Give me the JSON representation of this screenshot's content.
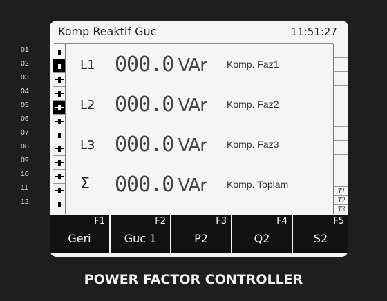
{
  "screen": {
    "title": "Komp Reaktif Guc",
    "clock": "11:51:27"
  },
  "channels": [
    "01",
    "02",
    "03",
    "04",
    "05",
    "06",
    "07",
    "08",
    "09",
    "10",
    "11",
    "12"
  ],
  "steps": [
    {
      "active": false
    },
    {
      "active": true
    },
    {
      "active": false
    },
    {
      "active": false
    },
    {
      "active": true
    },
    {
      "active": false
    },
    {
      "active": false
    },
    {
      "active": false
    },
    {
      "active": false
    },
    {
      "active": false
    },
    {
      "active": false
    },
    {
      "active": false
    }
  ],
  "readings": [
    {
      "label": "L1",
      "value": "000.0",
      "unit": "VAr",
      "desc": "Komp. Faz1"
    },
    {
      "label": "L2",
      "value": "000.0",
      "unit": "VAr",
      "desc": "Komp. Faz2"
    },
    {
      "label": "L3",
      "value": "000.0",
      "unit": "VAr",
      "desc": "Komp. Faz3"
    },
    {
      "label": "Σ",
      "value": "000.0",
      "unit": "VAr",
      "desc": "Komp. Toplam"
    }
  ],
  "side_tags": [
    "T1",
    "T2",
    "T3"
  ],
  "function_keys": [
    {
      "code": "F1",
      "label": "Geri"
    },
    {
      "code": "F2",
      "label": "Guc 1"
    },
    {
      "code": "F3",
      "label": "P2"
    },
    {
      "code": "F4",
      "label": "Q2"
    },
    {
      "code": "F5",
      "label": "S2"
    }
  ],
  "device": {
    "caption": "POWER FACTOR CONTROLLER"
  },
  "icons": {
    "step_indicator": "capacitor-icon"
  }
}
